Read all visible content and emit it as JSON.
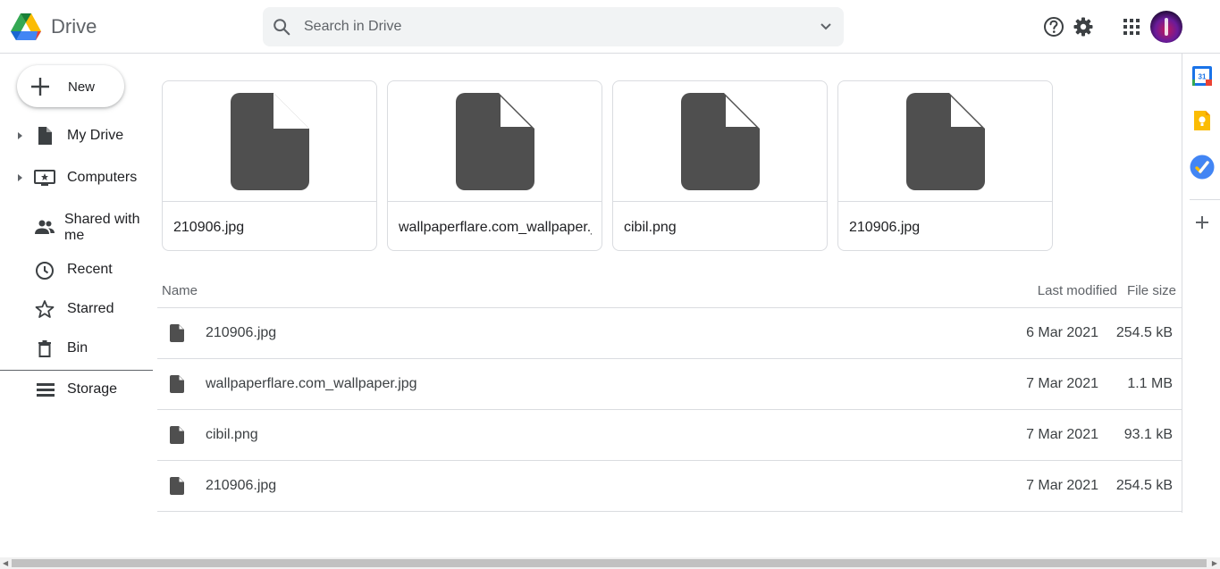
{
  "header": {
    "app_name": "Drive",
    "search_placeholder": "Search in Drive",
    "icons": [
      "drive-logo",
      "search-icon",
      "search-options-icon",
      "help-icon",
      "settings-icon",
      "apps-grid-icon",
      "avatar"
    ]
  },
  "sidebar": {
    "new_label": "New",
    "items": [
      {
        "label": "My Drive",
        "icon": "my-drive-icon"
      },
      {
        "label": "Computers",
        "icon": "computers-icon"
      },
      {
        "label": "Shared with me",
        "icon": "shared-icon"
      },
      {
        "label": "Recent",
        "icon": "clock-icon"
      },
      {
        "label": "Starred",
        "icon": "star-icon"
      },
      {
        "label": "Bin",
        "icon": "bin-icon"
      },
      {
        "label": "Storage",
        "icon": "storage-icon"
      }
    ]
  },
  "quick_access": [
    {
      "name": "210906.jpg"
    },
    {
      "name": "wallpaperflare.com_wallpaper.jpg"
    },
    {
      "name": "cibil.png"
    },
    {
      "name": "210906.jpg"
    }
  ],
  "file_list": {
    "columns": {
      "name": "Name",
      "modified": "Last modified",
      "size": "File size"
    },
    "rows": [
      {
        "name": "210906.jpg",
        "modified": "6 Mar 2021",
        "size": "254.5 kB"
      },
      {
        "name": "wallpaperflare.com_wallpaper.jpg",
        "modified": "7 Mar 2021",
        "size": "1.1 MB"
      },
      {
        "name": "cibil.png",
        "modified": "7 Mar 2021",
        "size": "93.1 kB"
      },
      {
        "name": "210906.jpg",
        "modified": "7 Mar 2021",
        "size": "254.5 kB"
      }
    ]
  },
  "side_panel": {
    "calendar_day": "31",
    "icons": [
      "calendar-icon",
      "keep-icon",
      "tasks-icon",
      "add-icon"
    ]
  },
  "colors": {
    "accent_blue": "#1a73e8",
    "keep_yellow": "#fbbc04",
    "file_icon_gray": "#4f4f4f",
    "text_gray": "#5f6368"
  }
}
